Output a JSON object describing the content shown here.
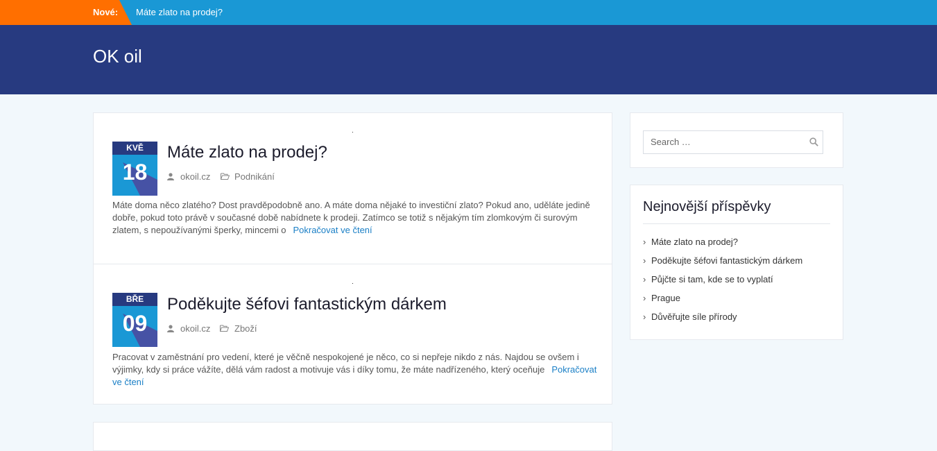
{
  "ticker": {
    "label": "Nové:",
    "text": "Máte zlato na prodej?"
  },
  "header": {
    "site_title": "OK oil"
  },
  "posts": [
    {
      "month": "KVĚ",
      "day": "18",
      "title": "Máte zlato na prodej?",
      "author": "okoil.cz",
      "category": "Podnikání",
      "excerpt": "Máte doma něco zlatého? Dost pravděpodobně ano. A máte doma nějaké to investiční zlato? Pokud ano, uděláte jedině dobře, pokud toto právě v současné době nabídnete k prodeji. Zatímco se totiž s nějakým tím zlomkovým či surovým zlatem, s nepoužívanými šperky, mincemi o",
      "read_more": "Pokračovat ve čtení"
    },
    {
      "month": "BŘE",
      "day": "09",
      "title": "Poděkujte šéfovi fantastickým dárkem",
      "author": "okoil.cz",
      "category": "Zboží",
      "excerpt": "Pracovat v zaměstnání pro vedení, které je věčně nespokojené je něco, co si nepřeje nikdo z nás. Najdou se ovšem i výjimky, kdy si práce vážíte, dělá vám radost a motivuje vás i díky tomu, že máte nadřízeného, který oceňuje",
      "read_more": "Pokračovat ve čtení"
    }
  ],
  "sidebar": {
    "search": {
      "placeholder": "Search …"
    },
    "recent": {
      "title": "Nejnovější příspěvky",
      "items": [
        "Máte zlato na prodej?",
        "Poděkujte šéfovi fantastickým dárkem",
        "Půjčte si tam, kde se to vyplatí",
        "Prague",
        "Důvěřujte síle přírody"
      ]
    }
  },
  "colors": {
    "ticker_bg": "#1a98d5",
    "ticker_label_bg": "#ff6f00",
    "header_bg": "#273a80",
    "link": "#1a7fc6",
    "page_bg": "#f2f8fc"
  },
  "icons": [
    "user-icon",
    "folder-icon",
    "search-icon",
    "chevron-right-icon"
  ]
}
